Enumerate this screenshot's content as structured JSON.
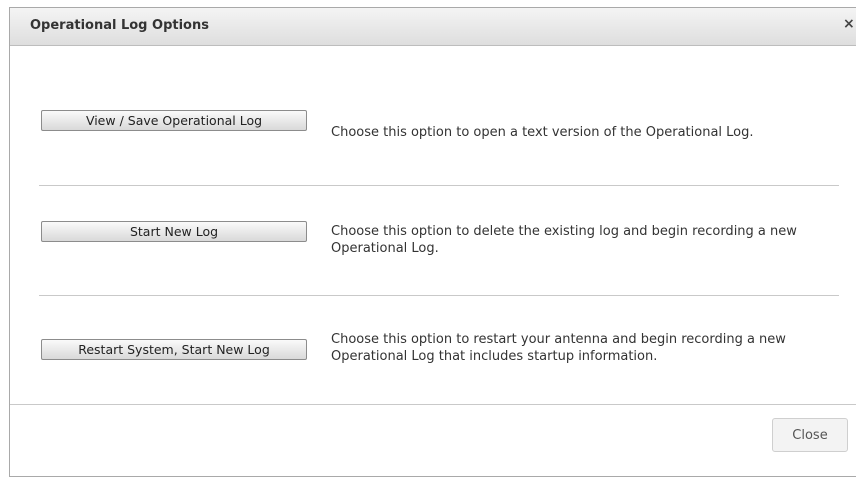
{
  "dialog": {
    "title": "Operational Log Options",
    "close_icon_glyph": "×"
  },
  "options": [
    {
      "button_label": "View / Save Operational Log",
      "description": "Choose this option to open a text version of the Operational Log."
    },
    {
      "button_label": "Start New Log",
      "description": "Choose this option to delete the existing log and begin recording a new Operational Log."
    },
    {
      "button_label": "Restart System, Start New Log",
      "description": "Choose this option to restart your antenna and begin recording a new Operational Log that includes startup information."
    }
  ],
  "footer": {
    "close_label": "Close"
  },
  "icons": {
    "close": "close-icon"
  }
}
